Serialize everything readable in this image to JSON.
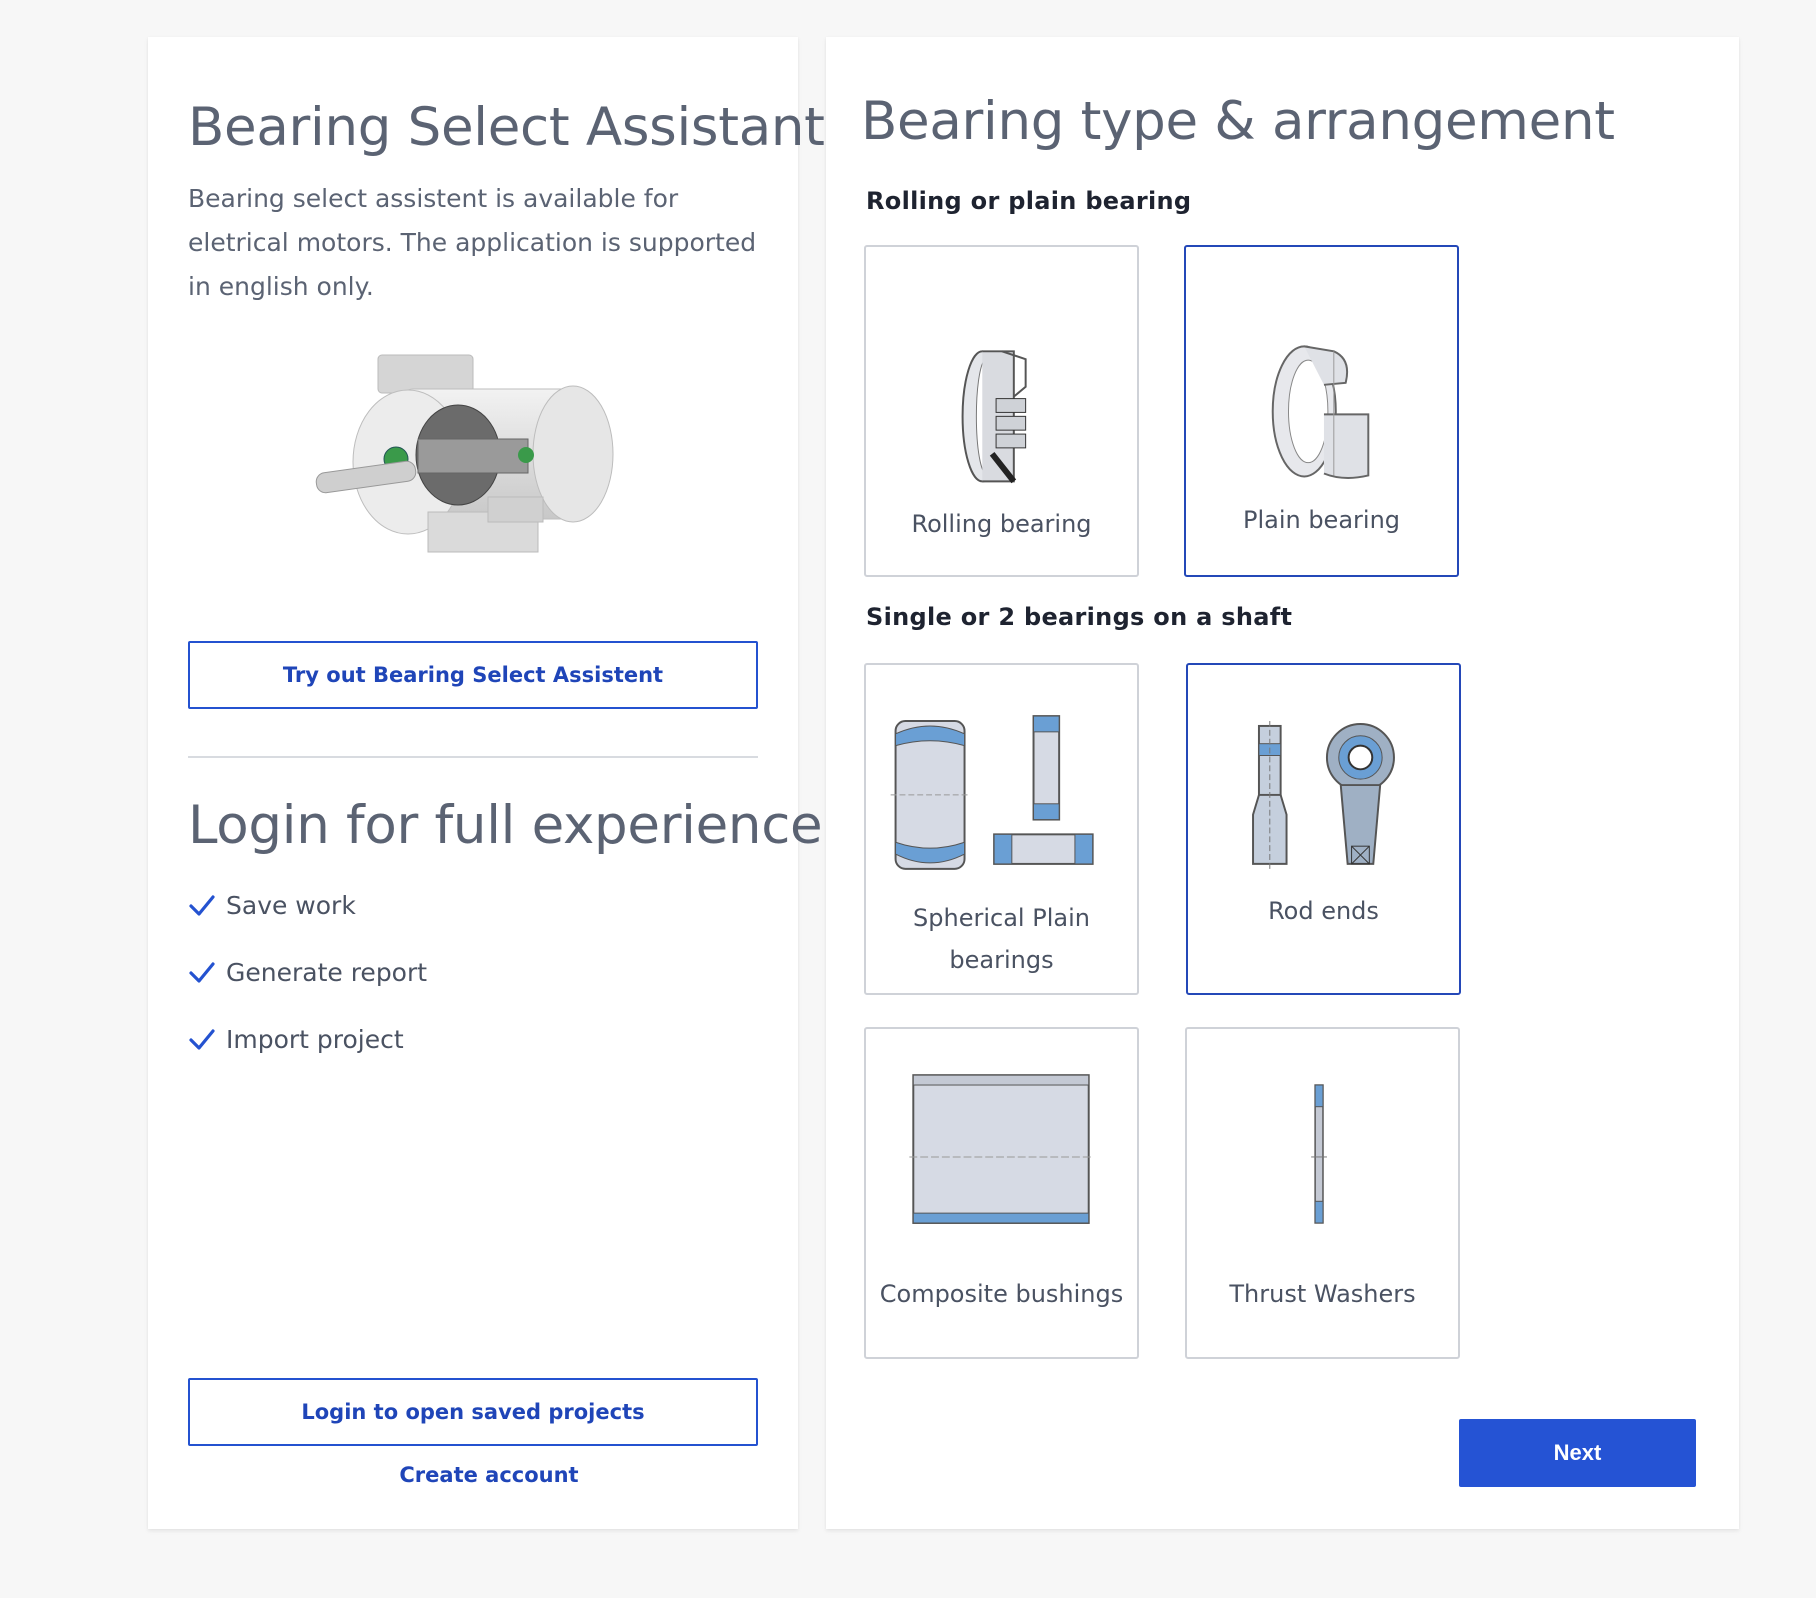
{
  "left": {
    "title": "Bearing Select Assistant",
    "description": "Bearing select assistent is available for eletrical motors. The application is supported in english only.",
    "try_button": "Try out Bearing Select Assistent",
    "login_title": "Login for full experience",
    "features": [
      "Save work",
      "Generate report",
      "Import project"
    ],
    "login_button": "Login to open saved projects",
    "create_account": "Create account"
  },
  "right": {
    "title": "Bearing type & arrangement",
    "section1": {
      "title": "Rolling or plain bearing",
      "options": [
        {
          "label": "Rolling bearing",
          "selected": false
        },
        {
          "label": "Plain bearing",
          "selected": true
        }
      ]
    },
    "section2": {
      "title": "Single or 2 bearings on a shaft",
      "options": [
        {
          "label": "Spherical Plain bearings",
          "selected": false
        },
        {
          "label": "Rod ends",
          "selected": true
        },
        {
          "label": "Composite bushings",
          "selected": false
        },
        {
          "label": "Thrust Washers",
          "selected": false
        }
      ]
    },
    "next_button": "Next"
  },
  "colors": {
    "accent": "#2553d4",
    "selected_border": "#2448b8",
    "card_border": "#cfd2d8",
    "bearing_blue": "#6a9fd4"
  }
}
